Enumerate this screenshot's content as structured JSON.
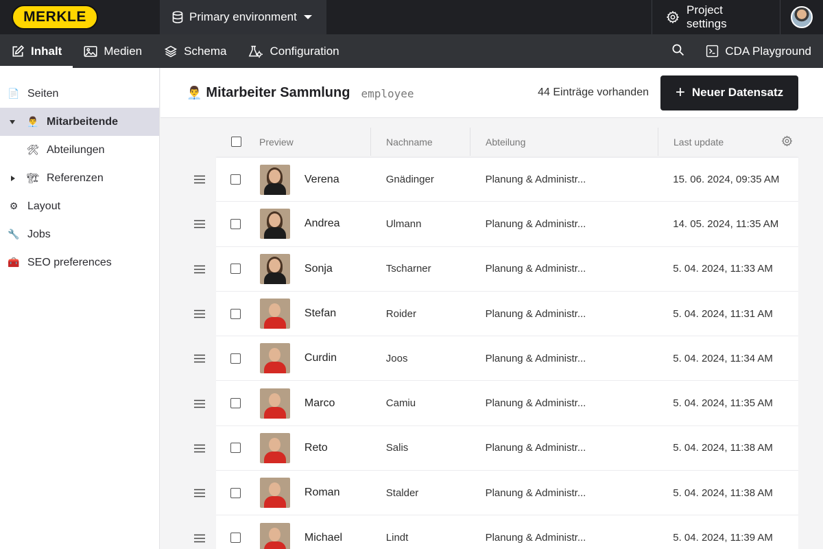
{
  "topbar": {
    "logo_text": "MERKLE",
    "environment": "Primary environment",
    "project_settings": "Project settings"
  },
  "nav": {
    "items": [
      {
        "label": "Inhalt",
        "icon": "edit-icon",
        "active": true
      },
      {
        "label": "Medien",
        "icon": "image-icon",
        "active": false
      },
      {
        "label": "Schema",
        "icon": "layers-icon",
        "active": false
      },
      {
        "label": "Configuration",
        "icon": "config-icon",
        "active": false
      }
    ],
    "cda_label": "CDA Playground"
  },
  "sidebar": {
    "items": [
      {
        "label": "Seiten",
        "icon": "📄"
      },
      {
        "label": "Mitarbeitende",
        "icon": "👨‍💼",
        "active": true,
        "expanded": true
      },
      {
        "label": "Abteilungen",
        "icon": "🛠"
      },
      {
        "label": "Referenzen",
        "icon": "🏗",
        "collapsed": true
      },
      {
        "label": "Layout",
        "icon": "⚙"
      },
      {
        "label": "Jobs",
        "icon": "🔧"
      },
      {
        "label": "SEO preferences",
        "icon": "🧰"
      }
    ]
  },
  "main": {
    "collection_icon": "👨‍💼",
    "title": "Mitarbeiter Sammlung",
    "api_key": "employee",
    "entries_count": "44 Einträge vorhanden",
    "new_button": "Neuer Datensatz"
  },
  "table": {
    "headers": {
      "preview": "Preview",
      "lastname": "Nachname",
      "department": "Abteilung",
      "last_update": "Last update"
    },
    "rows": [
      {
        "first": "Verena",
        "last": "Gnädinger",
        "dept": "Planung & Administr...",
        "updated": "15. 06. 2024, 09:35 AM",
        "shirt": "#1c1c1c",
        "female": true
      },
      {
        "first": "Andrea",
        "last": "Ulmann",
        "dept": "Planung & Administr...",
        "updated": "14. 05. 2024, 11:35 AM",
        "shirt": "#1c1c1c",
        "female": true
      },
      {
        "first": "Sonja",
        "last": "Tscharner",
        "dept": "Planung & Administr...",
        "updated": "5. 04. 2024, 11:33 AM",
        "shirt": "#1c1c1c",
        "female": true
      },
      {
        "first": "Stefan",
        "last": "Roider",
        "dept": "Planung & Administr...",
        "updated": "5. 04. 2024, 11:31 AM",
        "shirt": "#d42a23",
        "female": false
      },
      {
        "first": "Curdin",
        "last": "Joos",
        "dept": "Planung & Administr...",
        "updated": "5. 04. 2024, 11:34 AM",
        "shirt": "#d42a23",
        "female": false
      },
      {
        "first": "Marco",
        "last": "Camiu",
        "dept": "Planung & Administr...",
        "updated": "5. 04. 2024, 11:35 AM",
        "shirt": "#d42a23",
        "female": false
      },
      {
        "first": "Reto",
        "last": "Salis",
        "dept": "Planung & Administr...",
        "updated": "5. 04. 2024, 11:38 AM",
        "shirt": "#d42a23",
        "female": false
      },
      {
        "first": "Roman",
        "last": "Stalder",
        "dept": "Planung & Administr...",
        "updated": "5. 04. 2024, 11:38 AM",
        "shirt": "#d42a23",
        "female": false
      },
      {
        "first": "Michael",
        "last": "Lindt",
        "dept": "Planung & Administr...",
        "updated": "5. 04. 2024, 11:39 AM",
        "shirt": "#d42a23",
        "female": false
      }
    ]
  },
  "colors": {
    "topbar": "#1f2024",
    "navbar": "#323438",
    "accent_logo": "#ffd600",
    "sidebar_active": "#dcdce6"
  }
}
